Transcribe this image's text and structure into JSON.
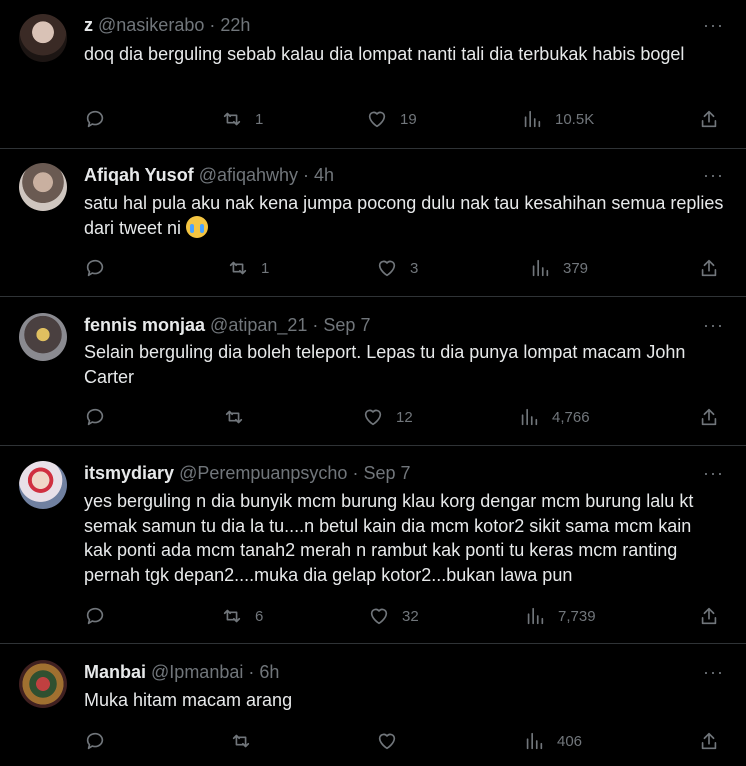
{
  "tweets": [
    {
      "name": "z",
      "handle": "@nasikerabo",
      "time": "· 22h",
      "text": "doq dia berguling sebab kalau dia lompat nanti tali dia terbukak habis bogel",
      "emoji": "",
      "replies": "",
      "retweets": "1",
      "likes": "19",
      "views": "10.5K"
    },
    {
      "name": "Afiqah Yusof",
      "handle": "@afiqahwhy",
      "time": "· 4h",
      "text": "satu hal pula aku nak kena jumpa pocong dulu nak tau kesahihan semua replies dari tweet ni",
      "emoji": "loudly-crying-face",
      "replies": "",
      "retweets": "1",
      "likes": "3",
      "views": "379"
    },
    {
      "name": "fennis monjaa",
      "handle": "@atipan_21",
      "time": "· Sep 7",
      "text": "Selain berguling dia boleh teleport. Lepas tu dia punya lompat macam John Carter",
      "emoji": "",
      "replies": "",
      "retweets": "",
      "likes": "12",
      "views": "4,766"
    },
    {
      "name": "itsmydiary",
      "handle": "@Perempuanpsycho",
      "time": "· Sep 7",
      "text": "yes berguling n dia bunyik mcm burung klau korg dengar mcm burung lalu kt semak samun tu dia la tu....n betul kain dia mcm kotor2 sikit sama mcm kain kak ponti ada mcm tanah2 merah n rambut kak ponti tu keras mcm ranting pernah tgk depan2....muka dia gelap kotor2...bukan lawa pun",
      "emoji": "",
      "replies": "",
      "retweets": "6",
      "likes": "32",
      "views": "7,739"
    },
    {
      "name": "Manbai",
      "handle": "@Ipmanbai",
      "time": "· 6h",
      "text": "Muka hitam macam arang",
      "emoji": "",
      "replies": "",
      "retweets": "",
      "likes": "",
      "views": "406"
    }
  ],
  "more_icon": "···",
  "colors": {
    "background": "#000000",
    "text": "#e7e9ea",
    "muted": "#71767b",
    "divider": "#2f3336"
  }
}
